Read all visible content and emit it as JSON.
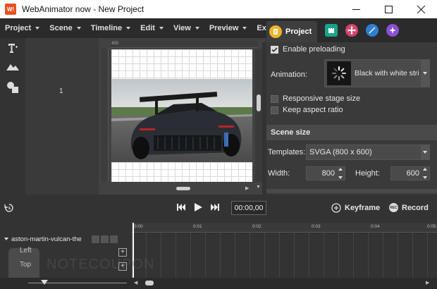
{
  "window": {
    "logo_text": "W!",
    "title": "WebAnimator now - New Project"
  },
  "menu": [
    {
      "label": "Project"
    },
    {
      "label": "Scene"
    },
    {
      "label": "Timeline"
    },
    {
      "label": "Edit"
    },
    {
      "label": "View"
    },
    {
      "label": "Preview"
    },
    {
      "label": "Exp"
    }
  ],
  "layers": {
    "frame_number": "1"
  },
  "rulers": {
    "top_first": "400"
  },
  "panel": {
    "active_tab": "Project",
    "enable_preloading": {
      "label": "Enable preloading",
      "checked": true
    },
    "animation_label": "Animation:",
    "animation_value": "Black with white stri",
    "responsive": {
      "label": "Responsive stage size",
      "checked": false
    },
    "aspect": {
      "label": "Keep aspect ratio",
      "checked": false
    },
    "scene_size_heading": "Scene size",
    "templates_label": "Templates:",
    "templates_value": "SVGA (800 x 600)",
    "width_label": "Width:",
    "width_value": "800",
    "height_label": "Height:",
    "height_value": "600"
  },
  "playback": {
    "time": "00:00,00",
    "keyframe_label": "Keyframe",
    "record_label": "Record",
    "record_icon_text": "REC"
  },
  "timeline": {
    "ticks": [
      "0:00",
      "0:01",
      "0:02",
      "0:03",
      "0:04",
      "0:05"
    ],
    "layer_name": "aston-martin-vulcan-the",
    "props": [
      "Left",
      "Top"
    ]
  },
  "watermark": {
    "text": "NOTECOUPON"
  },
  "colors": {
    "accent_orange": "#e8501f",
    "tab_yellow": "#f0b429",
    "tab_teal": "#1aa38a",
    "tab_pink": "#d9426c",
    "tab_blue": "#2f7fd0",
    "tab_purple": "#8a4fd6"
  }
}
